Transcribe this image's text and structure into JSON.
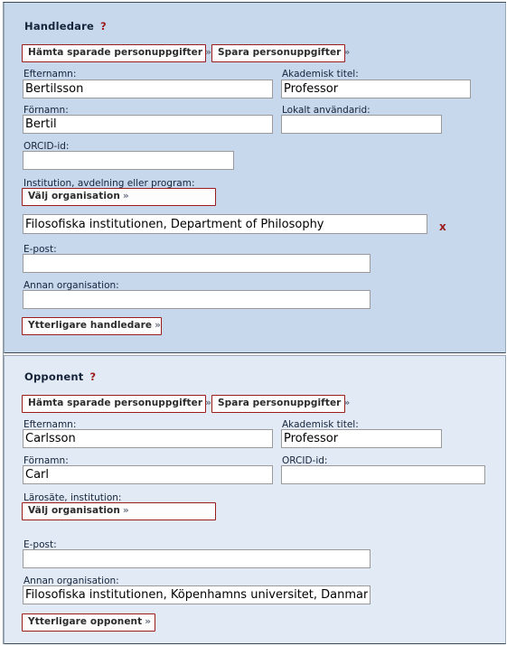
{
  "sections": [
    {
      "id": "supervisor",
      "title": "Handledare",
      "help": "?",
      "buttons": {
        "load": "Hämta sparade personuppgifter",
        "save": "Spara personuppgifter",
        "choose_org": "Välj organisation",
        "add_more": "Ytterligare handledare",
        "chevron": "»"
      },
      "fields": {
        "lastname_label": "Efternamn:",
        "lastname_value": "Bertilsson",
        "title_label": "Akademisk titel:",
        "title_value": "Professor",
        "firstname_label": "Förnamn:",
        "firstname_value": "Bertil",
        "localid_label": "Lokalt användarid:",
        "localid_value": "",
        "orcid_label": "ORCID-id:",
        "orcid_value": "",
        "org_label": "Institution, avdelning eller program:",
        "org_value": "Filosofiska institutionen, Department of Philosophy",
        "org_remove": "x",
        "email_label": "E-post:",
        "email_value": "",
        "otherorg_label": "Annan organisation:",
        "otherorg_value": ""
      }
    },
    {
      "id": "opponent",
      "title": "Opponent",
      "help": "?",
      "buttons": {
        "load": "Hämta sparade personuppgifter",
        "save": "Spara personuppgifter",
        "choose_org": "Välj organisation",
        "add_more": "Ytterligare opponent",
        "chevron": "»"
      },
      "fields": {
        "lastname_label": "Efternamn:",
        "lastname_value": "Carlsson",
        "title_label": "Akademisk titel:",
        "title_value": "Professor",
        "firstname_label": "Förnamn:",
        "firstname_value": "Carl",
        "orcid_label": "ORCID-id:",
        "orcid_value": "",
        "org_label": "Lärosäte, institution:",
        "email_label": "E-post:",
        "email_value": "",
        "otherorg_label": "Annan organisation:",
        "otherorg_value": "Filosofiska institutionen, Köpenhamns universitet, Danmark"
      }
    }
  ],
  "colors": {
    "panel_supervisor_bg": "#c7d7ec",
    "panel_opponent_bg": "#e1eaf5",
    "accent_red": "#9c1c1c",
    "label_text": "#16243a",
    "input_border": "#9a9a9a"
  }
}
